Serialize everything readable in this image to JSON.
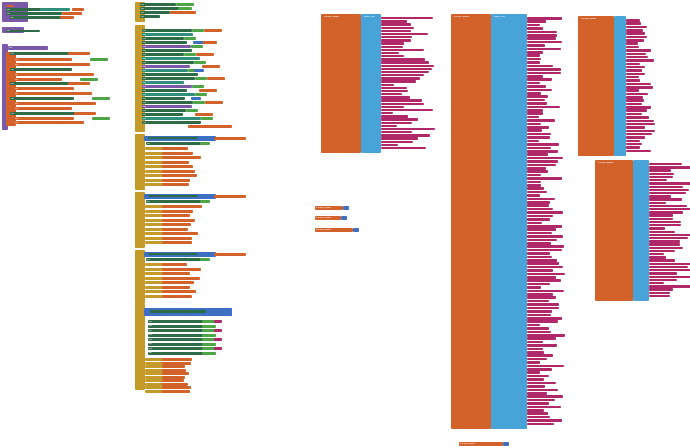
{
  "workspace": {
    "name": "blocks-workspace",
    "colors": {
      "background": "#ffffff",
      "event": "#c49a2b",
      "procedure": "#7a5aa8",
      "variable": "#d3612a",
      "math": "#3d6fc2",
      "logic": "#4ea547",
      "component": "#2f6b47",
      "text": "#b0286a",
      "list": "#48a4d8",
      "teal": "#2f8f7a"
    },
    "labels": {
      "global_initialize": "initialize global",
      "to_value": "to",
      "make_a_list": "make a list",
      "when": "when",
      "do": "do",
      "set": "set",
      "call": "call",
      "text_item": "text"
    }
  }
}
